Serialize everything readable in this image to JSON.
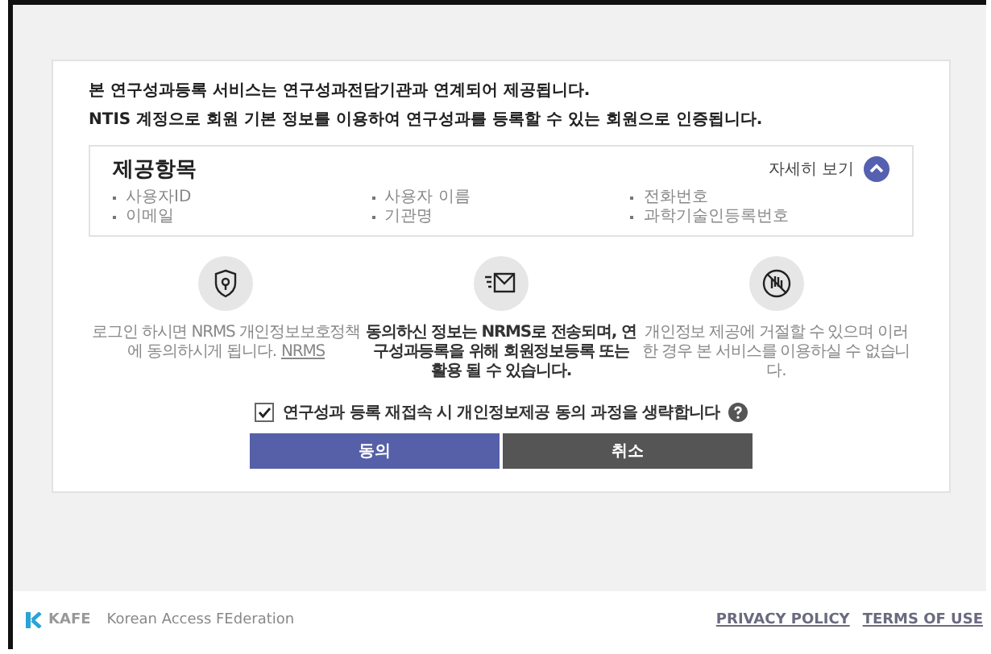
{
  "intro": [
    "본 연구성과등록 서비스는 연구성과전담기관과 연계되어 제공됩니다.",
    "NTIS 계정으로 회원 기본 정보를 이용하여 연구성과를 등록할 수 있는 회원으로 인증됩니다."
  ],
  "provision": {
    "title": "제공항목",
    "toggle_label": "자세히 보기",
    "expanded": true,
    "items": [
      "사용자ID",
      "사용자 이름",
      "전화번호",
      "이메일",
      "기관명",
      "과학기술인등록번호"
    ]
  },
  "notices": [
    {
      "kind": "shield",
      "text": "로그인 하시면 NRMS 개인정보보호정책에 동의하시게 됩니다.",
      "link": "NRMS",
      "bold": false
    },
    {
      "kind": "mail",
      "text": "동의하신 정보는 NRMS로 전송되며, 연구성과등록을 위해 회원정보등록 또는 활용 될 수 있습니다.",
      "bold": true
    },
    {
      "kind": "deny",
      "text": "개인정보 제공에 거절할 수 있으며 이러한 경우 본 서비스를 이용하실 수 없습니다.",
      "bold": false
    }
  ],
  "skip_consent": {
    "label": "연구성과 등록 재접속 시 개인정보제공 동의 과정을 생략합니다",
    "checked": true
  },
  "buttons": [
    {
      "label": "동의",
      "kind": "primary"
    },
    {
      "label": "취소",
      "kind": "secondary"
    }
  ],
  "footer": {
    "logo": "KAFE",
    "org": "Korean Access FEderation",
    "links": [
      "PRIVACY POLICY",
      "TERMS OF USE"
    ]
  }
}
